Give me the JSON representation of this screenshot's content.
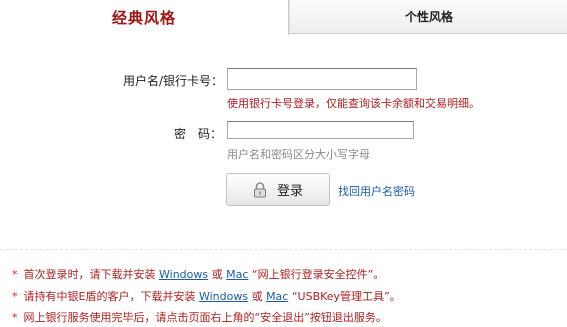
{
  "tabs": [
    {
      "label": "经典风格",
      "active": true
    },
    {
      "label": "个性风格",
      "active": false
    }
  ],
  "form": {
    "username_label": "用户名/银行卡号：",
    "username_value": "",
    "username_hint": "使用银行卡号登录，仅能查询该卡余额和交易明细。",
    "password_label": "密　码：",
    "password_value": "",
    "password_hint": "用户名和密码区分大小写字母",
    "login_button": "登录",
    "recover_link": "找回用户名密码"
  },
  "notices": [
    {
      "star": "*",
      "prefix": "首次登录时，请下载并安装",
      "link1": "Windows",
      "conj": "或",
      "link2": "Mac",
      "suffix": "“网上银行登录安全控件”。"
    },
    {
      "star": "*",
      "prefix": "请持有中银E盾的客户，下载并安装",
      "link1": "Windows",
      "conj": "或",
      "link2": "Mac",
      "suffix": "“USBKey管理工具”。"
    },
    {
      "star": "*",
      "text": "网上银行服务使用完毕后，请点击页面右上角的“安全退出”按钮退出服务。"
    }
  ],
  "colors": {
    "accent_red": "#a01515",
    "hint_red": "#b12020",
    "link_blue": "#1a5ca8"
  }
}
